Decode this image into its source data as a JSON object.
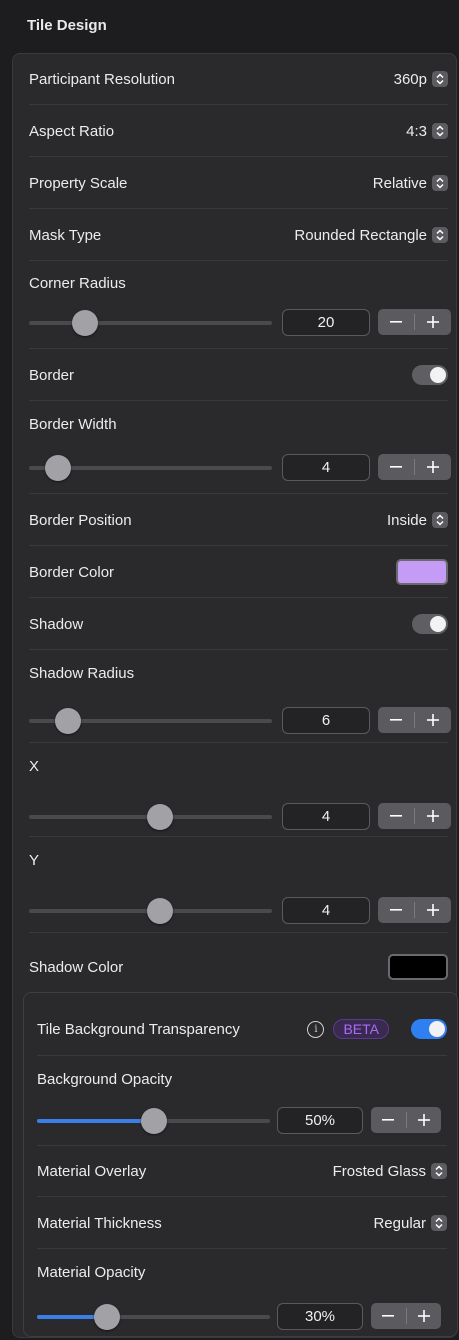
{
  "header": {
    "title": "Tile Design"
  },
  "rows": {
    "participant_resolution": {
      "label": "Participant Resolution",
      "value": "360p"
    },
    "aspect_ratio": {
      "label": "Aspect Ratio",
      "value": "4:3"
    },
    "property_scale": {
      "label": "Property Scale",
      "value": "Relative"
    },
    "mask_type": {
      "label": "Mask Type",
      "value": "Rounded Rectangle"
    },
    "corner_radius": {
      "label": "Corner Radius",
      "value": "20",
      "level": 0.23
    },
    "border": {
      "label": "Border",
      "enabled": true
    },
    "border_width": {
      "label": "Border Width",
      "value": "4",
      "level": 0.12
    },
    "border_position": {
      "label": "Border Position",
      "value": "Inside"
    },
    "border_color": {
      "label": "Border Color",
      "color": "#c49bf5"
    },
    "shadow": {
      "label": "Shadow",
      "enabled": true
    },
    "shadow_radius": {
      "label": "Shadow Radius",
      "value": "6",
      "level": 0.16
    },
    "x": {
      "label": "X",
      "value": "4",
      "level": 0.54
    },
    "y": {
      "label": "Y",
      "value": "4",
      "level": 0.54
    },
    "shadow_color": {
      "label": "Shadow Color",
      "color": "#000000"
    }
  },
  "transparency": {
    "label": "Tile Background Transparency",
    "badge": "BETA",
    "info_icon": "info-icon",
    "enabled": true,
    "background_opacity": {
      "label": "Background Opacity",
      "value": "50%",
      "level": 0.5
    },
    "material_overlay": {
      "label": "Material Overlay",
      "value": "Frosted Glass"
    },
    "material_thickness": {
      "label": "Material Thickness",
      "value": "Regular"
    },
    "material_opacity": {
      "label": "Material Opacity",
      "value": "30%",
      "level": 0.3
    }
  },
  "stepper": {
    "minus": "−",
    "plus": "+"
  },
  "colors": {
    "accent": "#2f7ff0",
    "beta": "#a86cf5"
  }
}
